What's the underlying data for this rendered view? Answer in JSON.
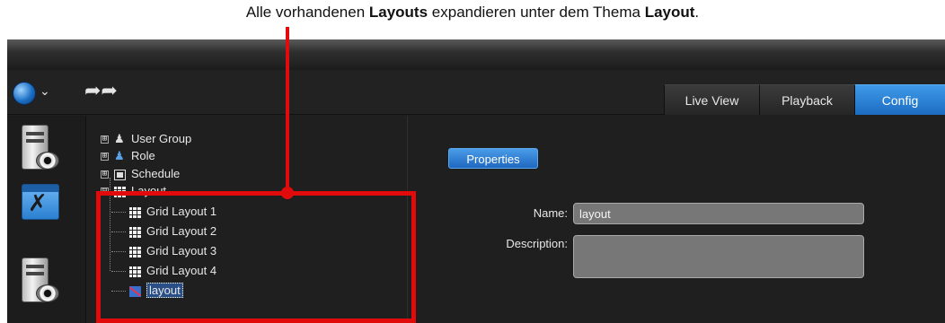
{
  "caption": {
    "part1": "Alle vorhandenen ",
    "bold1": "Layouts",
    "part2": " expandieren unter dem Thema ",
    "bold2": "Layout",
    "part3": "."
  },
  "toolbar": {
    "menu_chevron": "⌄",
    "forward_arrows": "➦➦"
  },
  "tabs": [
    {
      "label": "Live View",
      "active": false
    },
    {
      "label": "Playback",
      "active": false
    },
    {
      "label": "Config",
      "active": true
    }
  ],
  "tree": {
    "items": [
      {
        "label": "User Group",
        "expander": "⊞",
        "icon": "user-group-icon"
      },
      {
        "label": "Role",
        "expander": "⊞",
        "icon": "role-icon"
      },
      {
        "label": "Schedule",
        "expander": "⊞",
        "icon": "schedule-icon"
      },
      {
        "label": "Layout",
        "expander": "⊟",
        "icon": "grid-layout-icon",
        "children": [
          {
            "label": "Grid Layout 1",
            "icon": "grid-layout-icon"
          },
          {
            "label": "Grid Layout 2",
            "icon": "grid-layout-icon"
          },
          {
            "label": "Grid Layout 3",
            "icon": "grid-layout-icon"
          },
          {
            "label": "Grid Layout 4",
            "icon": "grid-layout-icon"
          },
          {
            "label": "layout",
            "icon": "custom-layout-icon",
            "selected": true
          }
        ]
      }
    ]
  },
  "properties": {
    "button_label": "Properties",
    "name_label": "Name:",
    "name_value": "layout",
    "description_label": "Description:",
    "description_value": ""
  },
  "colors": {
    "highlight": "#e10b0b",
    "accent": "#2a7fd0"
  }
}
